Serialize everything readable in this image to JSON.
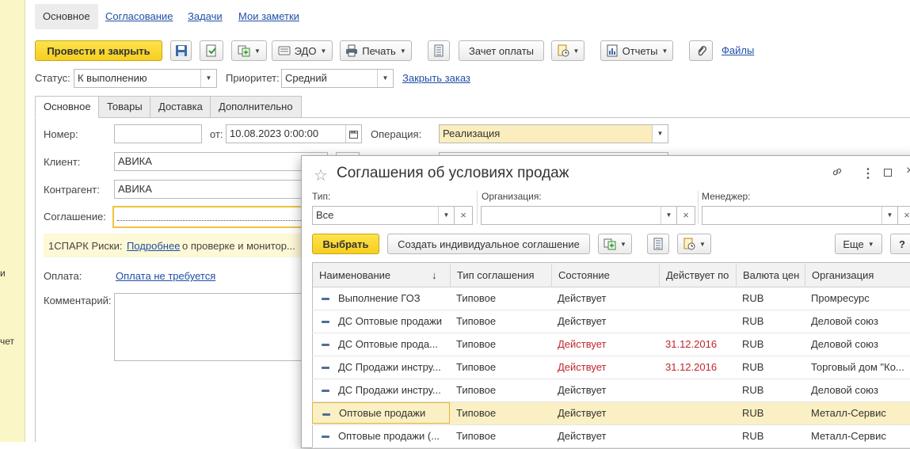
{
  "left_strip": {
    "text1": "и",
    "text2": "чет"
  },
  "nav_tabs": [
    {
      "label": "Основное"
    },
    {
      "label": "Согласование"
    },
    {
      "label": "Задачи"
    },
    {
      "label": "Мои заметки"
    }
  ],
  "toolbar": {
    "post_close": "Провести и закрыть",
    "edo": "ЭДО",
    "print": "Печать",
    "offset": "Зачет оплаты",
    "reports": "Отчеты",
    "files": "Файлы"
  },
  "status_row": {
    "status_label": "Статус:",
    "status_value": "К выполнению",
    "priority_label": "Приоритет:",
    "priority_value": "Средний",
    "close_order": "Закрыть заказ"
  },
  "form_tabs": [
    {
      "label": "Основное"
    },
    {
      "label": "Товары"
    },
    {
      "label": "Доставка"
    },
    {
      "label": "Дополнительно"
    }
  ],
  "form": {
    "number_label": "Номер:",
    "number_value": "",
    "from_label": "от:",
    "date_value": "10.08.2023  0:00:00",
    "operation_label": "Операция:",
    "operation_value": "Реализация",
    "client_label": "Клиент:",
    "client_value": "АВИКА",
    "counterparty_label": "Контрагент:",
    "counterparty_value": "АВИКА",
    "agreement_label": "Соглашение:",
    "agreement_value": "",
    "spark_prefix": "1СПАРК Риски:",
    "spark_link": "Подробнее",
    "spark_suffix": "о проверке и монитор...",
    "payment_label": "Оплата:",
    "payment_link": "Оплата не требуется",
    "comment_label": "Комментарий:"
  },
  "popup": {
    "title": "Соглашения об условиях продаж",
    "filters": {
      "type_label": "Тип:",
      "type_value": "Все",
      "org_label": "Организация:",
      "org_value": "",
      "manager_label": "Менеджер:",
      "manager_value": ""
    },
    "select_btn": "Выбрать",
    "create_btn": "Создать индивидуальное соглашение",
    "more_btn": "Еще",
    "help_btn": "?",
    "columns": [
      "Наименование",
      "Тип соглашения",
      "Состояние",
      "Действует по",
      "Валюта цен",
      "Организация"
    ],
    "sort_indicator": "↓",
    "rows": [
      {
        "name": "Выполнение ГОЗ",
        "type": "Типовое",
        "state": "Действует",
        "until": "",
        "currency": "RUB",
        "org": "Промресурс",
        "red": false,
        "selected": false
      },
      {
        "name": "ДС Оптовые продажи",
        "type": "Типовое",
        "state": "Действует",
        "until": "",
        "currency": "RUB",
        "org": "Деловой союз",
        "red": false,
        "selected": false
      },
      {
        "name": "ДС Оптовые прода...",
        "type": "Типовое",
        "state": "Действует",
        "until": "31.12.2016",
        "currency": "RUB",
        "org": "Деловой союз",
        "red": true,
        "selected": false
      },
      {
        "name": "ДС Продажи инстру...",
        "type": "Типовое",
        "state": "Действует",
        "until": "31.12.2016",
        "currency": "RUB",
        "org": "Торговый дом \"Ко...",
        "red": true,
        "selected": false
      },
      {
        "name": "ДС Продажи инстру...",
        "type": "Типовое",
        "state": "Действует",
        "until": "",
        "currency": "RUB",
        "org": "Деловой союз",
        "red": false,
        "selected": false
      },
      {
        "name": "Оптовые продажи",
        "type": "Типовое",
        "state": "Действует",
        "until": "",
        "currency": "RUB",
        "org": "Металл-Сервис",
        "red": false,
        "selected": true
      },
      {
        "name": "Оптовые продажи (...",
        "type": "Типовое",
        "state": "Действует",
        "until": "",
        "currency": "RUB",
        "org": "Металл-Сервис",
        "red": false,
        "selected": false
      }
    ]
  }
}
